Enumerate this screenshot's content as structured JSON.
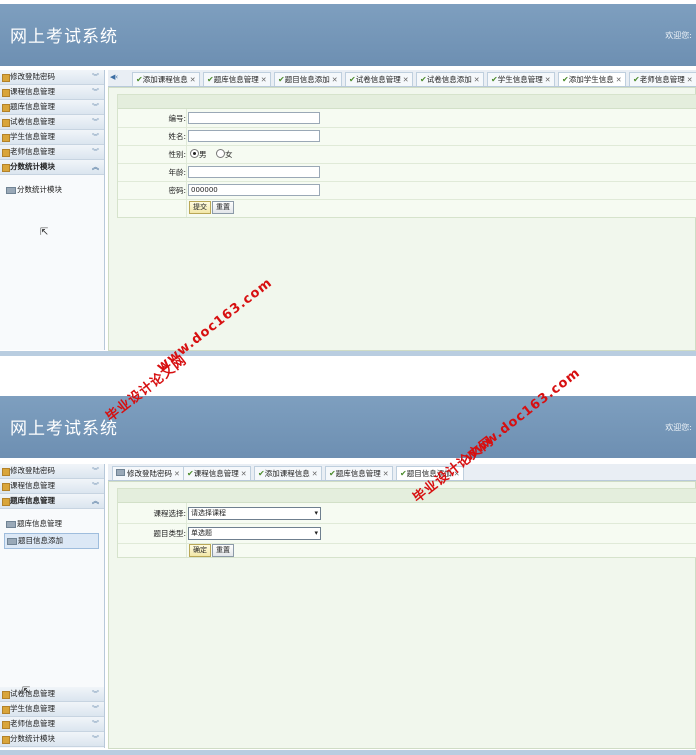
{
  "app_title": "网上考试系统",
  "screen1": {
    "welcome": "欢迎您:",
    "sidebar": {
      "items": [
        {
          "label": "修改登陆密码"
        },
        {
          "label": "课程信息管理"
        },
        {
          "label": "题库信息管理"
        },
        {
          "label": "试卷信息管理"
        },
        {
          "label": "学生信息管理"
        },
        {
          "label": "老师信息管理"
        },
        {
          "label": "分数统计模块"
        }
      ],
      "sub_items": [
        {
          "label": "分数统计模块"
        }
      ]
    },
    "tabs": [
      {
        "label": "添加课程信息"
      },
      {
        "label": "题库信息管理"
      },
      {
        "label": "题目信息添加"
      },
      {
        "label": "试卷信息管理"
      },
      {
        "label": "试卷信息添加"
      },
      {
        "label": "学生信息管理"
      },
      {
        "label": "添加学生信息"
      },
      {
        "label": "老师信息管理"
      }
    ],
    "form": {
      "id_label": "编号:",
      "name_label": "姓名:",
      "gender_label": "性别:",
      "gender_options": [
        "男",
        "女"
      ],
      "gender_selected": "男",
      "age_label": "年龄:",
      "password_label": "密码:",
      "password_value": "000000",
      "submit_label": "提交",
      "reset_label": "重置"
    }
  },
  "screen2": {
    "welcome": "欢迎您:",
    "sidebar": {
      "top_items": [
        {
          "label": "修改登陆密码"
        },
        {
          "label": "课程信息管理"
        },
        {
          "label": "题库信息管理"
        }
      ],
      "sub_items": [
        {
          "label": "题库信息管理"
        },
        {
          "label": "题目信息添加"
        }
      ],
      "bottom_items": [
        {
          "label": "试卷信息管理"
        },
        {
          "label": "学生信息管理"
        },
        {
          "label": "老师信息管理"
        },
        {
          "label": "分数统计模块"
        }
      ]
    },
    "tabs": [
      {
        "label": "修改登陆密码"
      },
      {
        "label": "课程信息管理"
      },
      {
        "label": "添加课程信息"
      },
      {
        "label": "题库信息管理"
      },
      {
        "label": "题目信息添加"
      }
    ],
    "form": {
      "course_label": "课程选择:",
      "course_value": "请选择课程",
      "type_label": "题目类型:",
      "type_value": "单选题",
      "confirm_label": "确定",
      "reset_label": "重置"
    }
  },
  "watermark": {
    "cn": "毕业设计论文网",
    "url": "www.doc163.com"
  },
  "colors": {
    "header": "#7394b7",
    "sidebar_bg": "#f4f7fb",
    "content_bg": "#f1f7ed",
    "watermark": "#d70f10"
  }
}
